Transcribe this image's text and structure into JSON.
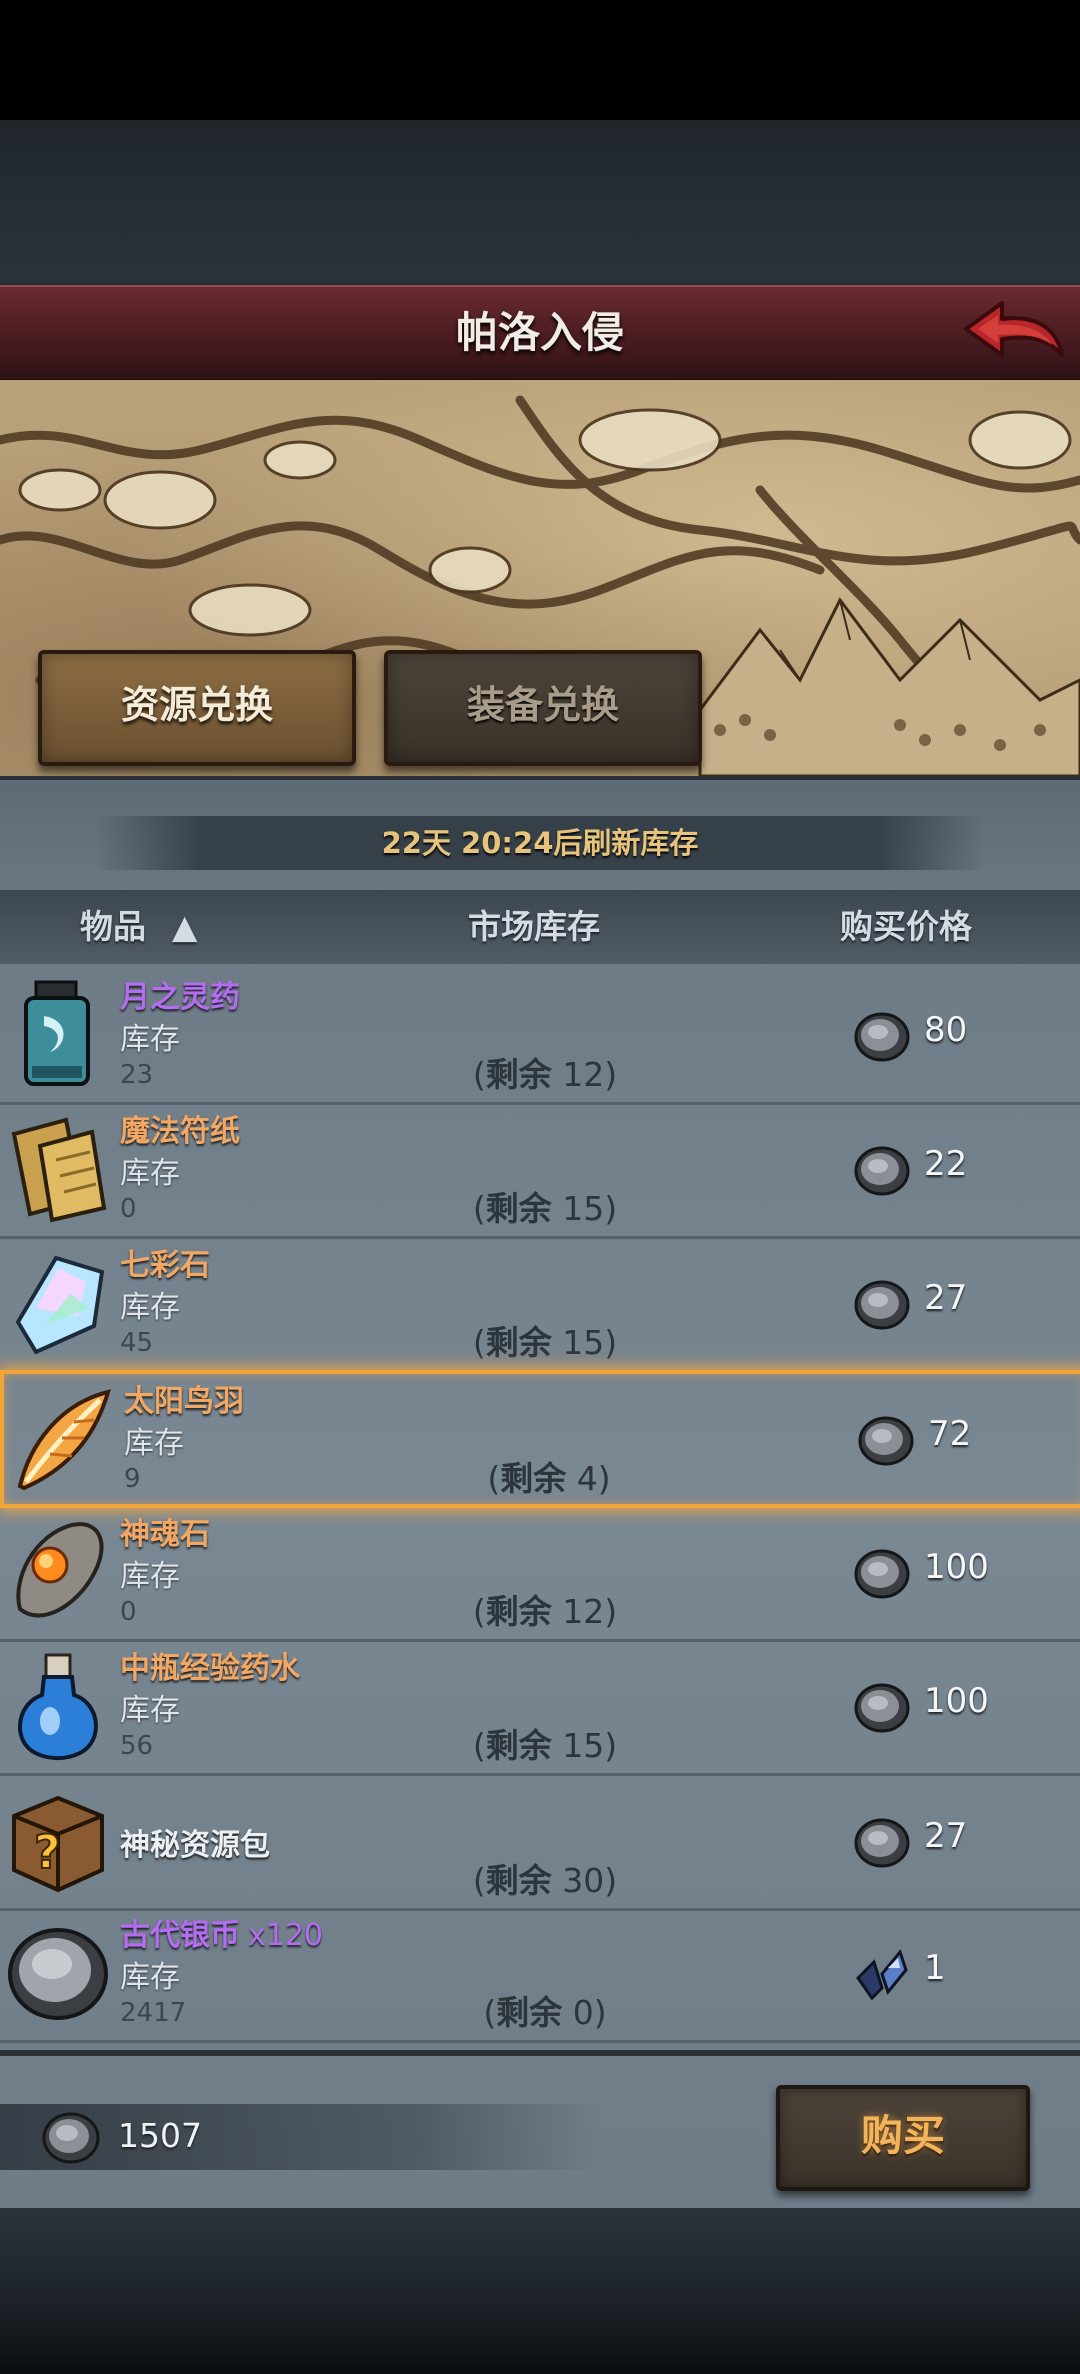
{
  "header": {
    "title": "帕洛入侵"
  },
  "tabs": [
    {
      "label": "资源兑换",
      "active": true
    },
    {
      "label": "装备兑换",
      "active": false
    }
  ],
  "refresh_text": "22天 20:24后刷新库存",
  "columns": {
    "item": "物品",
    "market_stock": "市场库存",
    "price": "购买价格"
  },
  "items": [
    {
      "name": "月之灵药",
      "suffix": "",
      "name_color": "purple",
      "stock_label": "库存",
      "stock": "23",
      "remain_label": "剩余",
      "remain": "12",
      "price": "80",
      "currency": "silver-coin"
    },
    {
      "name": "魔法符纸",
      "suffix": "",
      "name_color": "orange",
      "stock_label": "库存",
      "stock": "0",
      "remain_label": "剩余",
      "remain": "15",
      "price": "22",
      "currency": "silver-coin"
    },
    {
      "name": "七彩石",
      "suffix": "",
      "name_color": "orange",
      "stock_label": "库存",
      "stock": "45",
      "remain_label": "剩余",
      "remain": "15",
      "price": "27",
      "currency": "silver-coin"
    },
    {
      "name": "太阳鸟羽",
      "suffix": "",
      "name_color": "orange",
      "stock_label": "库存",
      "stock": "9",
      "remain_label": "剩余",
      "remain": "4",
      "price": "72",
      "currency": "silver-coin",
      "selected": true
    },
    {
      "name": "神魂石",
      "suffix": "",
      "name_color": "orange",
      "stock_label": "库存",
      "stock": "0",
      "remain_label": "剩余",
      "remain": "12",
      "price": "100",
      "currency": "silver-coin"
    },
    {
      "name": "中瓶经验药水",
      "suffix": "",
      "name_color": "orange",
      "stock_label": "库存",
      "stock": "56",
      "remain_label": "剩余",
      "remain": "15",
      "price": "100",
      "currency": "silver-coin"
    },
    {
      "name": "神秘资源包",
      "suffix": "",
      "name_color": "white",
      "stock_label": "",
      "stock": "",
      "remain_label": "剩余",
      "remain": "30",
      "price": "27",
      "currency": "silver-coin"
    },
    {
      "name": "古代银币",
      "suffix": "x120",
      "name_color": "purple",
      "stock_label": "库存",
      "stock": "2417",
      "remain_label": "剩余",
      "remain": "0",
      "price": "1",
      "currency": "crystal-shard"
    }
  ],
  "footer": {
    "balance": "1507",
    "buy_label": "购买"
  }
}
